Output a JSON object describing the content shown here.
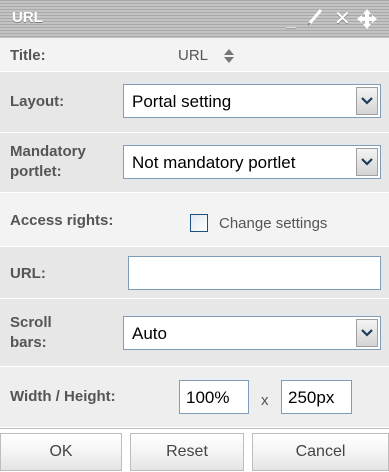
{
  "window": {
    "title": "URL",
    "controls": {
      "minimize": "_",
      "edit_icon": "pencil-icon",
      "close": "✕",
      "move_icon": "move-icon"
    }
  },
  "fields": {
    "title": {
      "label": "Title:",
      "value": "URL",
      "sort_icon": "updown-arrow-icon"
    },
    "layout": {
      "label": "Layout:",
      "selected": "Portal setting"
    },
    "mandatory": {
      "label_line1": "Mandatory",
      "label_line2": "portlet:",
      "selected": "Not mandatory portlet"
    },
    "access": {
      "label": "Access rights:",
      "checkbox_label": "Change settings",
      "checked": false
    },
    "url": {
      "label": "URL:",
      "value": ""
    },
    "scroll": {
      "label_line1": "Scroll",
      "label_line2": "bars:",
      "selected": "Auto"
    },
    "size": {
      "label": "Width / Height:",
      "width": "100%",
      "separator": "x",
      "height": "250px"
    }
  },
  "buttons": {
    "ok": "OK",
    "reset": "Reset",
    "cancel": "Cancel"
  },
  "colors": {
    "titlebar": "#b5b5b5",
    "label_text": "#555555",
    "input_border": "#7f9db9",
    "row_bg": "#e7e7e7"
  }
}
